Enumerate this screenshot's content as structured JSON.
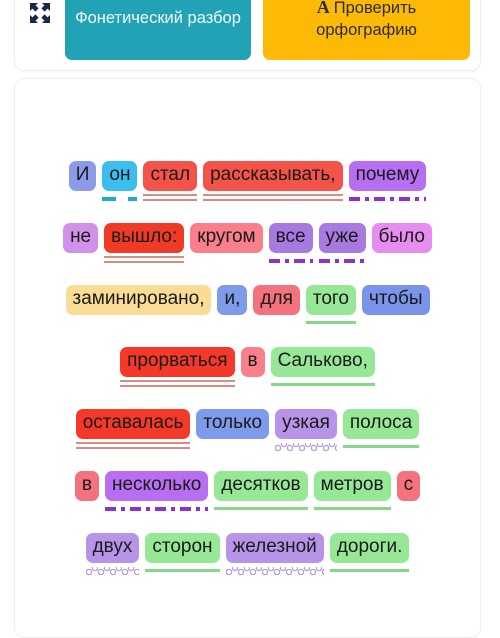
{
  "toolbar": {
    "expand_icon": "expand-arrows-icon",
    "phonetic_button": "Фонетический разбор",
    "spell_button": "Проверить орфографию",
    "spell_icon_letter": "A",
    "colors": {
      "phonetic_bg": "#22a3b5",
      "phonetic_text": "#f2fbfc",
      "spell_bg": "#fcba07",
      "spell_text": "#2c2c2c"
    }
  },
  "parse": {
    "lines": [
      {
        "words": [
          {
            "text": "И",
            "bg": "#8b9bea",
            "rule": "none"
          },
          {
            "text": "он",
            "bg": "#3cbdf0",
            "rule": "dash-cyan"
          },
          {
            "text": "стал",
            "bg": "#f4534a",
            "rule": "double-red"
          },
          {
            "text": "рассказывать,",
            "bg": "#f4534a",
            "rule": "double-red"
          },
          {
            "text": "почему",
            "bg": "#b76ef0",
            "rule": "dashdot-purple"
          }
        ]
      },
      {
        "words": [
          {
            "text": "не",
            "bg": "#cf92e8",
            "rule": "none"
          },
          {
            "text": "вышло:",
            "bg": "#ef3b26",
            "rule": "double-red"
          },
          {
            "text": "кругом",
            "bg": "#f9808a",
            "rule": "none"
          },
          {
            "text": "все",
            "bg": "#a87ae0",
            "rule": "dashdot-purple"
          },
          {
            "text": "уже",
            "bg": "#a87ae0",
            "rule": "dashdot-purple"
          },
          {
            "text": "было",
            "bg": "#e58ef0",
            "rule": "none"
          }
        ]
      },
      {
        "words": [
          {
            "text": "заминировано,",
            "bg": "#fadc96",
            "rule": "none"
          },
          {
            "text": "и,",
            "bg": "#7e9aea",
            "rule": "none"
          },
          {
            "text": "для",
            "bg": "#f4727e",
            "rule": "none"
          },
          {
            "text": "того",
            "bg": "#96e896",
            "rule": "single-green"
          },
          {
            "text": "чтобы",
            "bg": "#7a94ea",
            "rule": "none"
          }
        ]
      },
      {
        "words": [
          {
            "text": "прорваться",
            "bg": "#f4392a",
            "rule": "double-red"
          },
          {
            "text": "в",
            "bg": "#f9808a",
            "rule": "none"
          },
          {
            "text": "Сальково,",
            "bg": "#96e896",
            "rule": "single-green"
          }
        ]
      },
      {
        "words": [
          {
            "text": "оставалась",
            "bg": "#f4392a",
            "rule": "double-red"
          },
          {
            "text": "только",
            "bg": "#7e9aea",
            "rule": "none"
          },
          {
            "text": "узкая",
            "bg": "#b794e8",
            "rule": "wave-purple"
          },
          {
            "text": "полоса",
            "bg": "#96e896",
            "rule": "single-green"
          }
        ]
      },
      {
        "words": [
          {
            "text": "в",
            "bg": "#f4727e",
            "rule": "none"
          },
          {
            "text": "несколько",
            "bg": "#b76ef0",
            "rule": "dashdot-purple"
          },
          {
            "text": "десятков",
            "bg": "#96e896",
            "rule": "single-green"
          },
          {
            "text": "метров",
            "bg": "#96e896",
            "rule": "single-green"
          },
          {
            "text": "с",
            "bg": "#f4727e",
            "rule": "none"
          }
        ]
      },
      {
        "words": [
          {
            "text": "двух",
            "bg": "#b794e8",
            "rule": "wave-purple"
          },
          {
            "text": "сторон",
            "bg": "#96e896",
            "rule": "single-green"
          },
          {
            "text": "железной",
            "bg": "#b794e8",
            "rule": "wave-purple"
          },
          {
            "text": "дороги.",
            "bg": "#96e896",
            "rule": "single-green"
          }
        ]
      }
    ]
  }
}
